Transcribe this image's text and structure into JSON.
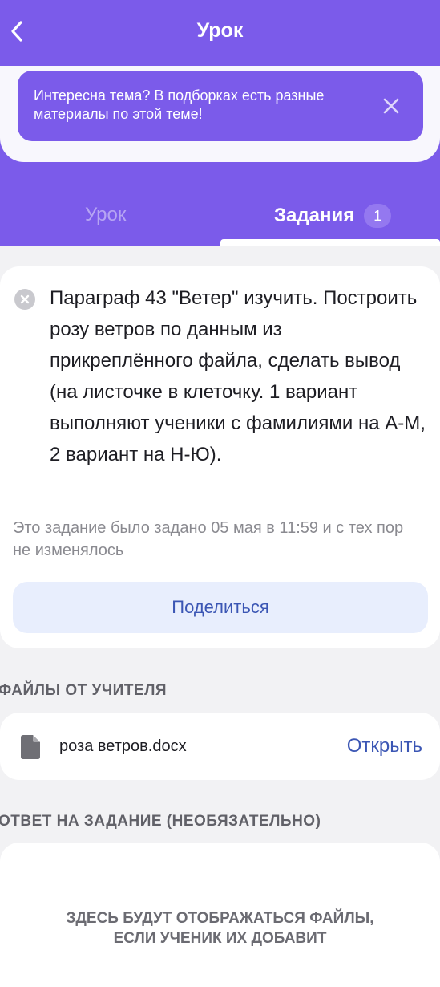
{
  "header": {
    "title": "Урок",
    "back_icon": "chevron-left-icon"
  },
  "banner": {
    "text": "Интересна тема? В подборках есть разные материалы по этой теме!",
    "close_icon": "close-icon"
  },
  "tabs": [
    {
      "label": "Урок",
      "active": false
    },
    {
      "label": "Задания",
      "active": true,
      "badge": "1"
    }
  ],
  "task": {
    "status_icon": "cancel-circle-icon",
    "text": "Параграф 43 \"Ветер\" изучить. Построить розу ветров по данным из прикреплённого файла, сделать вывод (на листочке в клеточку.  1 вариант выполняют ученики с фамилиями на А-М, 2 вариант на Н-Ю).",
    "meta": "Это задание было задано 05 мая в 11:59 и с тех пор не изменялось",
    "share_label": "Поделиться"
  },
  "files": {
    "header": "ФАЙЛЫ ОТ УЧИТЕЛЯ",
    "items": [
      {
        "name": "роза ветров.docx",
        "icon": "file-icon",
        "action": "Открыть"
      }
    ]
  },
  "answer": {
    "header": "ОТВЕТ НА ЗАДАНИЕ (НЕОБЯЗАТЕЛЬНО)",
    "placeholder_line1": "ЗДЕСЬ БУДУТ ОТОБРАЖАТЬСЯ ФАЙЛЫ,",
    "placeholder_line2": "ЕСЛИ УЧЕНИК ИХ ДОБАВИТ"
  },
  "colors": {
    "brand": "#7b5bea",
    "link": "#3b56b4",
    "background": "#f2f2f4"
  }
}
